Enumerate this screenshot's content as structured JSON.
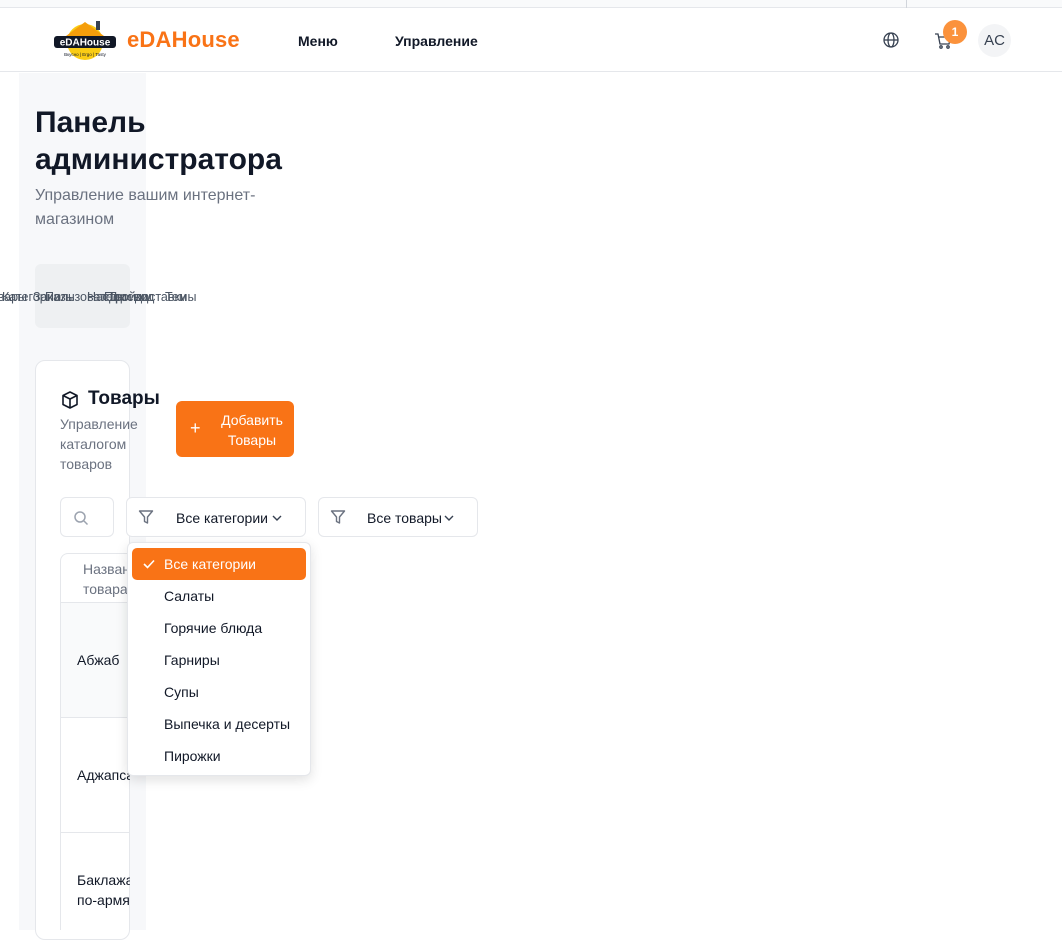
{
  "header": {
    "logo_text": "eDAHouse",
    "logo_tagline": "Вкусно | Ergo | Tasty",
    "brand": "eDAHouse",
    "nav": [
      "Меню",
      "Управление"
    ],
    "cart_count": "1",
    "avatar_initials": "AC"
  },
  "page": {
    "title": "Панель администратора",
    "subtitle": "Управление вашим интернет-магазином"
  },
  "tabs": [
    {
      "label": "Товары"
    },
    {
      "label": "Категории"
    },
    {
      "label": "Заказы"
    },
    {
      "label": "Пользователи"
    },
    {
      "label": "Настройки"
    },
    {
      "label": "Перевод"
    },
    {
      "label": "Дни доставки"
    },
    {
      "label": "Темы"
    }
  ],
  "products_card": {
    "title": "Товары",
    "description": "Управление каталогом товаров",
    "add_button": "Добавить Товары",
    "category_filter_value": "Все категории",
    "status_filter_value": "Все товары",
    "table_header": "Название товара",
    "rows": [
      "Абжаб",
      "Аджапсандали",
      "Баклажаны\nпо-армянски"
    ]
  },
  "category_dropdown": {
    "selected": "Все категории",
    "options": [
      "Все категории",
      "Салаты",
      "Горячие блюда",
      "Гарниры",
      "Супы",
      "Выпечка и десерты",
      "Пирожки"
    ]
  },
  "colors": {
    "accent": "#f97316",
    "badge": "#fb923c",
    "muted_text": "#6b7280",
    "border": "#e5e7eb"
  },
  "icons": [
    "globe-icon",
    "cart-icon",
    "box-icon",
    "plus-icon",
    "search-icon",
    "filter-icon",
    "chevron-down-icon",
    "check-icon"
  ]
}
